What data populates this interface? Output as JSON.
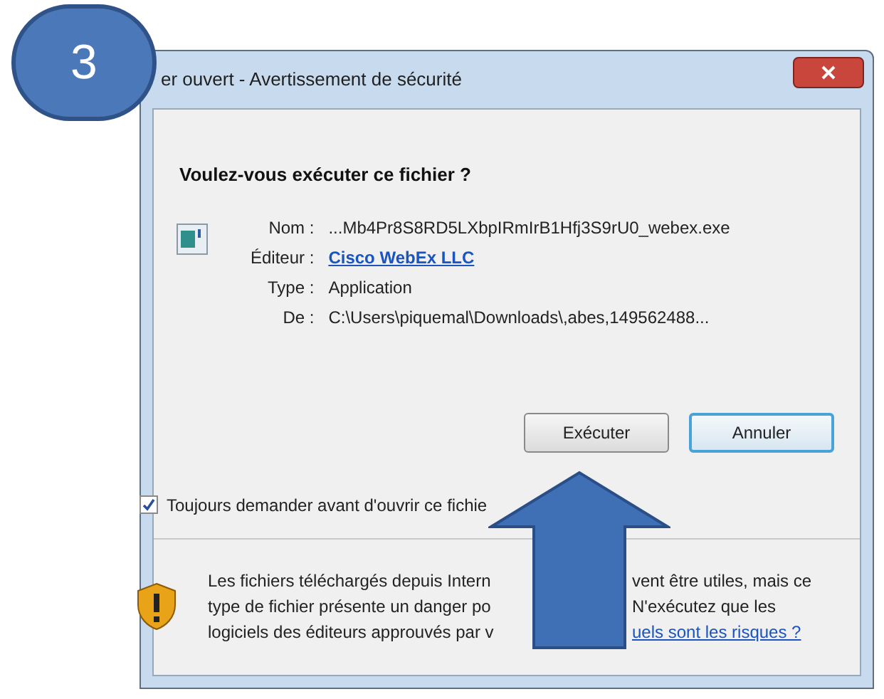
{
  "badge": {
    "text": "3"
  },
  "window": {
    "title": "er ouvert - Avertissement de sécurité"
  },
  "heading": "Voulez-vous exécuter ce fichier ?",
  "details": [
    {
      "label": "Nom :",
      "value": "...Mb4Pr8S8RD5LXbpIRmIrB1Hfj3S9rU0_webex.exe",
      "kind": "text"
    },
    {
      "label": "Éditeur :",
      "value": "Cisco WebEx LLC",
      "kind": "link"
    },
    {
      "label": "Type :",
      "value": "Application",
      "kind": "text"
    },
    {
      "label": "De :",
      "value": "C:\\Users\\piquemal\\Downloads\\,abes,149562488...",
      "kind": "text"
    }
  ],
  "buttons": [
    {
      "label": "Exécuter",
      "focused": false
    },
    {
      "label": "Annuler",
      "focused": true
    }
  ],
  "checkbox": {
    "label": "Toujours demander avant d'ouvrir ce fichie",
    "checked": true
  },
  "warning": {
    "lines": [
      {
        "left": "Les fichiers téléchargés depuis Intern",
        "right": "vent être utiles, mais ce",
        "link": false
      },
      {
        "left": "type de fichier présente un danger po",
        "right": "N'exécutez que les",
        "link": false
      },
      {
        "left": "logiciels des éditeurs approuvés par v",
        "right": "uels sont les risques ?",
        "link": true
      }
    ]
  }
}
